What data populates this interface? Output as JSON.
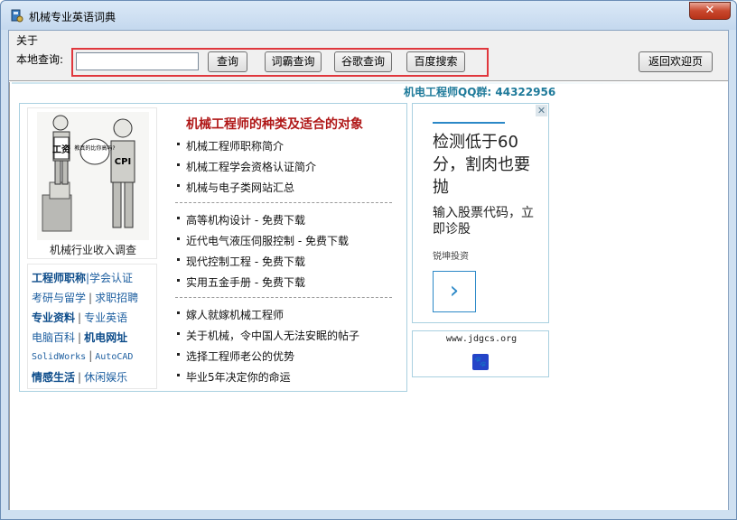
{
  "window": {
    "title": "机械专业英语词典",
    "close_label": "✕"
  },
  "menu": {
    "about": "关于"
  },
  "toolbar": {
    "local_label": "本地查询:",
    "search_value": "",
    "buttons": {
      "query": "查询",
      "ciba": "词霸查询",
      "google": "谷歌查询",
      "baidu": "百度搜索",
      "home": "返回欢迎页"
    }
  },
  "page": {
    "qq_group": "机电工程师QQ群: 44322956",
    "cartoon": {
      "caption": "机械行业收入调查",
      "label_left": "工资",
      "label_right": "CPI",
      "speech": "教真的比你高吗?"
    },
    "side_links": [
      [
        {
          "text": "工程师职称",
          "bold": true
        },
        {
          "text": "|学会认证",
          "bold": false
        }
      ],
      [
        {
          "text": "考研与留学",
          "bold": false
        },
        {
          "text": "求职招聘",
          "bold": false
        }
      ],
      [
        {
          "text": "专业资料",
          "bold": true
        },
        {
          "text": "专业英语",
          "bold": false
        }
      ],
      [
        {
          "text": "电脑百科",
          "bold": false
        },
        {
          "text": "机电网址",
          "bold": true
        }
      ],
      [
        {
          "text": "SolidWorks",
          "bold": false,
          "mono": true
        },
        {
          "text": "AutoCAD",
          "bold": false,
          "mono": true
        }
      ],
      [
        {
          "text": "情感生活",
          "bold": true
        },
        {
          "text": "休闲娱乐",
          "bold": false
        }
      ]
    ],
    "article_title": "机械工程师的种类及适合的对象",
    "group1": [
      "机械工程师职称简介",
      "机械工程学会资格认证简介",
      "机械与电子类网站汇总"
    ],
    "group2": [
      "高等机构设计 - 免费下载",
      "近代电气液压伺服控制 - 免费下载",
      "现代控制工程 - 免费下载",
      "实用五金手册 - 免费下载"
    ],
    "group3": [
      "嫁人就嫁机械工程师",
      "关于机械，令中国人无法安眠的帖子",
      "选择工程师老公的优势",
      "毕业5年决定你的命运"
    ]
  },
  "ad": {
    "close": "✕",
    "headline": "检测低于60分，割肉也要抛",
    "sub": "输入股票代码，立即诊股",
    "brand": "锐坤投资",
    "arrow": "›"
  },
  "mini": {
    "domain": "www.jdgcs.org",
    "paw": "🐾"
  }
}
